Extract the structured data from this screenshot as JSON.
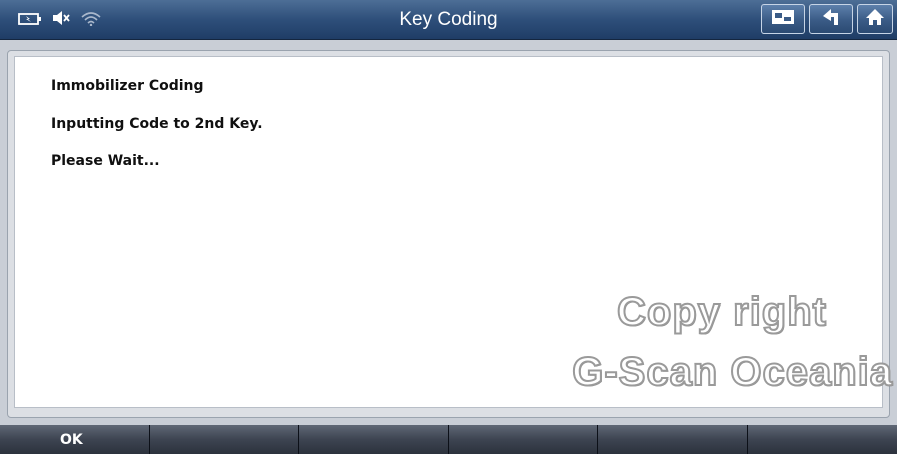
{
  "header": {
    "title": "Key Coding",
    "status_icons": [
      "battery-icon",
      "mute-icon",
      "wifi-icon"
    ],
    "buttons": [
      "monitor-icon",
      "back-arrow-icon",
      "home-icon"
    ]
  },
  "content": {
    "lines": [
      "Immobilizer Coding",
      "Inputting Code to 2nd Key.",
      "Please Wait..."
    ]
  },
  "watermark": {
    "line1": "Copy right",
    "line2": "G-Scan Oceania"
  },
  "function_keys": [
    "OK",
    "",
    "",
    "",
    "",
    ""
  ],
  "colors": {
    "titlebar": "#2e4f7a",
    "panel": "#ffffff",
    "function_bar": "#3d4451"
  }
}
